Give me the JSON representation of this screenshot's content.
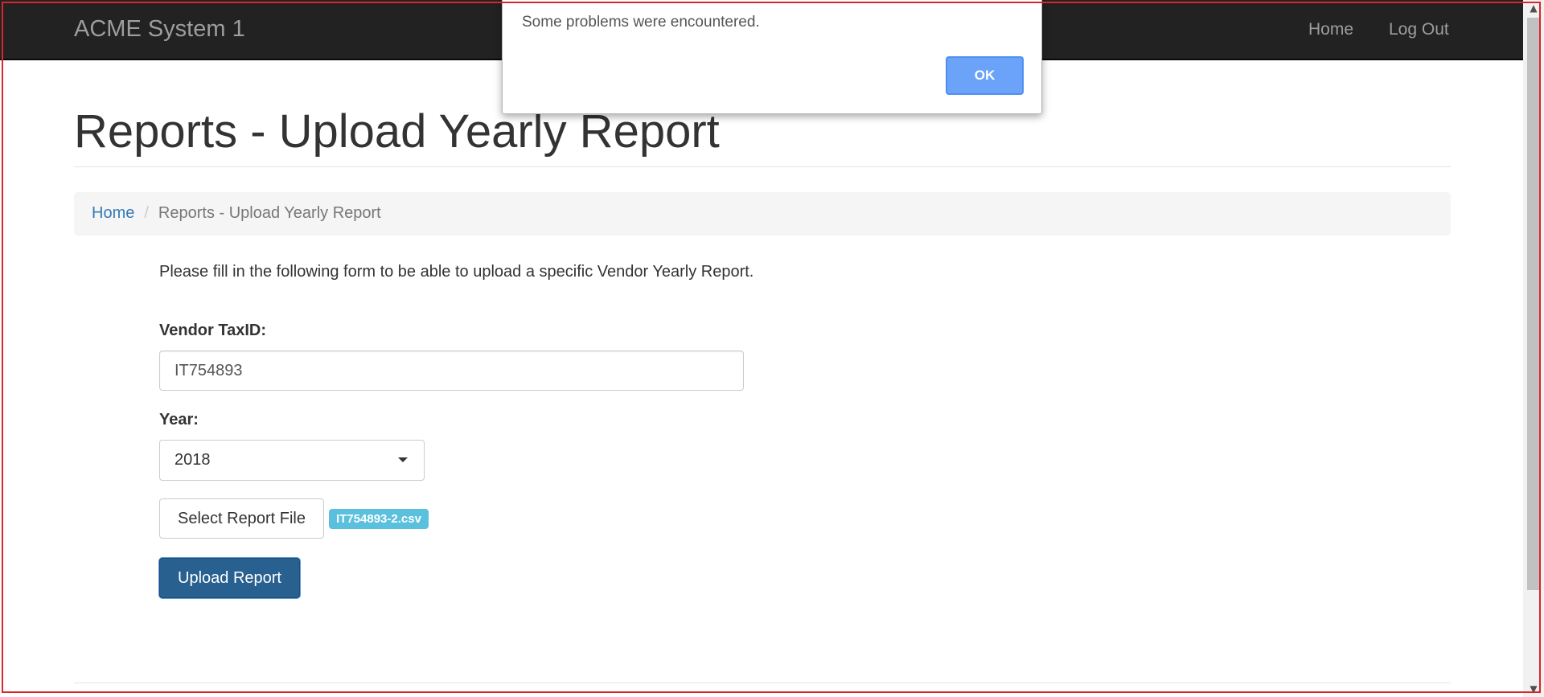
{
  "navbar": {
    "brand": "ACME System 1",
    "links": [
      {
        "label": "Home"
      },
      {
        "label": "Log Out"
      }
    ]
  },
  "page": {
    "title": "Reports - Upload Yearly Report"
  },
  "breadcrumb": {
    "home": "Home",
    "separator": "/",
    "current": "Reports - Upload Yearly Report"
  },
  "form": {
    "intro": "Please fill in the following form to be able to upload a specific Vendor Yearly Report.",
    "vendor_taxid_label": "Vendor TaxID:",
    "vendor_taxid_value": "IT754893",
    "year_label": "Year:",
    "year_value": "2018",
    "select_file_label": "Select Report File",
    "selected_file_name": "IT754893-2.csv",
    "upload_label": "Upload Report"
  },
  "dialog": {
    "message": "Some problems were encountered.",
    "ok_label": "OK"
  },
  "colors": {
    "navbar_bg": "#222222",
    "link": "#337ab7",
    "primary_button": "#286090",
    "info_badge": "#5bc0de",
    "dialog_ok": "#6aa3f7",
    "frame_border": "#d9262b"
  },
  "icons": {
    "select_caret": "caret-down-icon",
    "scroll_up": "scroll-up-arrow-icon",
    "scroll_down": "scroll-down-arrow-icon"
  }
}
